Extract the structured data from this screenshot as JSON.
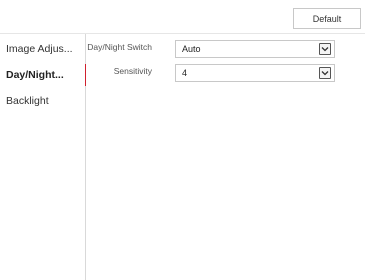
{
  "toolbar": {
    "default_label": "Default"
  },
  "sidebar": {
    "items": [
      {
        "label": "Image Adjus...",
        "active": false
      },
      {
        "label": "Day/Night...",
        "active": true
      },
      {
        "label": "Backlight",
        "active": false
      }
    ],
    "active_color": "#d0202e"
  },
  "form": {
    "day_night_switch": {
      "label": "Day/Night Switch",
      "value": "Auto",
      "icon": "chevron-down-icon"
    },
    "sensitivity": {
      "label": "Sensitivity",
      "value": "4",
      "icon": "chevron-down-icon"
    }
  }
}
